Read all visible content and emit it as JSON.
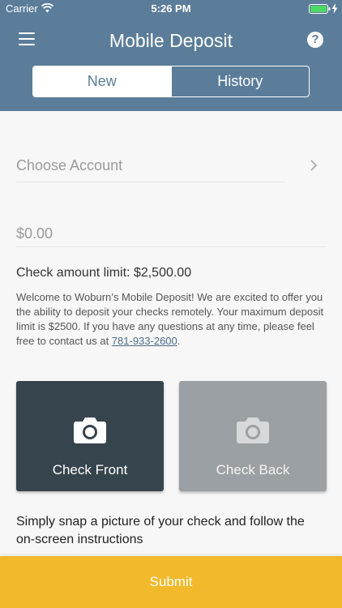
{
  "status_bar": {
    "carrier": "Carrier",
    "time": "5:26 PM",
    "battery_fill": 1.0
  },
  "header": {
    "title": "Mobile Deposit",
    "menu_icon": "hamburger-menu-icon",
    "help_icon": "help-question-icon",
    "help_glyph": "?",
    "background_color": "#5b7d9a"
  },
  "tabs": [
    {
      "label": "New",
      "active": true
    },
    {
      "label": "History",
      "active": false
    }
  ],
  "form": {
    "account_placeholder": "Choose Account",
    "amount_placeholder": "$0.00"
  },
  "info": {
    "limit_text": "Check amount limit: $2,500.00",
    "welcome_text": "Welcome to Woburn’s Mobile Deposit! We are excited to offer you the ability to deposit your checks remotely. Your maximum deposit limit is $2500. If you have any questions at any time, please feel free to contact us at ",
    "phone": "781-933-2600",
    "welcome_end": "."
  },
  "checks": {
    "front_label": "Check Front",
    "back_label": "Check Back",
    "front_color": "#36444d",
    "back_color": "#9aa0a3"
  },
  "instructions": "Simply snap a picture of your check and follow the on-screen instructions",
  "submit": {
    "label": "Submit",
    "color": "#f1b92b"
  }
}
